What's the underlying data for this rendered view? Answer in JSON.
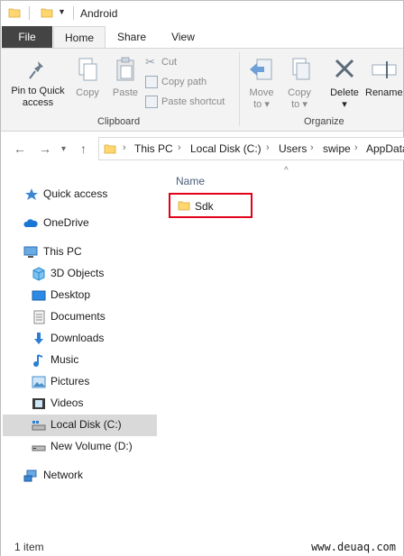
{
  "window": {
    "title": "Android"
  },
  "ribbon_tabs": [
    "File",
    "Home",
    "Share",
    "View"
  ],
  "clipboard": {
    "pin_label_1": "Pin to Quick",
    "pin_label_2": "access",
    "copy": "Copy",
    "paste": "Paste",
    "cut": "Cut",
    "copy_path": "Copy path",
    "paste_shortcut": "Paste shortcut",
    "group": "Clipboard"
  },
  "organize": {
    "move_to_1": "Move",
    "move_to_2": "to",
    "copy_to_1": "Copy",
    "copy_to_2": "to",
    "delete": "Delete",
    "rename": "Rename",
    "group": "Organize"
  },
  "address": {
    "crumbs": [
      "This PC",
      "Local Disk (C:)",
      "Users",
      "swipe",
      "AppData"
    ]
  },
  "sidebar": {
    "items": [
      {
        "label": "Quick access",
        "icon": "star-icon"
      },
      {
        "label": "OneDrive",
        "icon": "cloud-icon"
      },
      {
        "label": "This PC",
        "icon": "computer-icon"
      },
      {
        "label": "3D Objects",
        "icon": "cube-icon"
      },
      {
        "label": "Desktop",
        "icon": "desktop-icon"
      },
      {
        "label": "Documents",
        "icon": "document-icon"
      },
      {
        "label": "Downloads",
        "icon": "download-icon"
      },
      {
        "label": "Music",
        "icon": "music-icon"
      },
      {
        "label": "Pictures",
        "icon": "pictures-icon"
      },
      {
        "label": "Videos",
        "icon": "videos-icon"
      },
      {
        "label": "Local Disk (C:)",
        "icon": "drive-icon"
      },
      {
        "label": "New Volume (D:)",
        "icon": "drive-icon"
      },
      {
        "label": "Network",
        "icon": "network-icon"
      }
    ],
    "selected": "Local Disk (C:)"
  },
  "content": {
    "column_header": "Name",
    "files": [
      {
        "name": "Sdk",
        "icon": "folder-icon"
      }
    ]
  },
  "status": {
    "item_count": "1 item",
    "watermark": "www.deuaq.com"
  },
  "colors": {
    "accent": "#2b579a",
    "highlight_border": "#e2001a",
    "folder": "#ffd76e",
    "selection": "#d9d9d9"
  }
}
